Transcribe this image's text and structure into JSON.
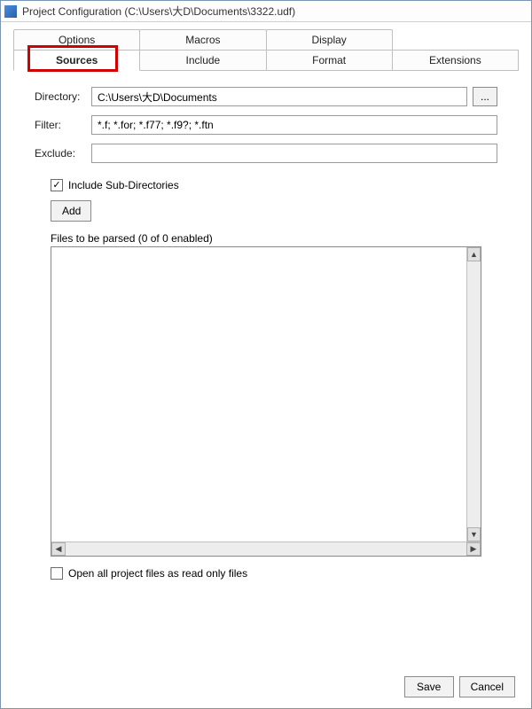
{
  "window": {
    "title": "Project Configuration (C:\\Users\\大D\\Documents\\3322.udf)"
  },
  "tabs": {
    "row1": [
      {
        "label": "Options"
      },
      {
        "label": "Macros"
      },
      {
        "label": "Display"
      }
    ],
    "row2": [
      {
        "label": "Sources",
        "active": true
      },
      {
        "label": "Include"
      },
      {
        "label": "Format"
      },
      {
        "label": "Extensions"
      }
    ]
  },
  "form": {
    "directory_label": "Directory:",
    "directory_value": "C:\\Users\\大D\\Documents",
    "browse_label": "...",
    "filter_label": "Filter:",
    "filter_value": "*.f; *.for; *.f77; *.f9?; *.ftn",
    "exclude_label": "Exclude:",
    "exclude_value": ""
  },
  "options": {
    "include_subdirs_label": "Include Sub-Directories",
    "include_subdirs_checked": true,
    "add_button": "Add",
    "files_label": "Files to be parsed (0 of 0 enabled)",
    "open_readonly_label": "Open all project files as read only files",
    "open_readonly_checked": false
  },
  "footer": {
    "save": "Save",
    "cancel": "Cancel"
  }
}
